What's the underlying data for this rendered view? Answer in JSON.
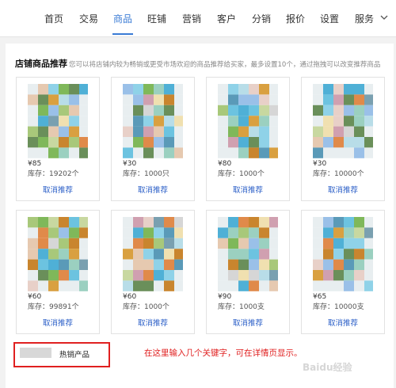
{
  "nav": {
    "items": [
      "首页",
      "交易",
      "商品",
      "旺铺",
      "营销",
      "客户",
      "分销",
      "报价",
      "设置",
      "服务"
    ],
    "active_index": 2,
    "active_color": "#3a7bd5"
  },
  "section": {
    "title": "店铺商品推荐",
    "description": "您可以将店铺内较为畅销或更受市场欢迎的商品推荐给买家，最多设置10个，通过拖拽可以改变推荐商品"
  },
  "products": [
    {
      "price": "¥85",
      "stock": "库存：19202个",
      "action": "取消推荐"
    },
    {
      "price": "¥30",
      "stock": "库存：1000只",
      "action": "取消推荐"
    },
    {
      "price": "¥80",
      "stock": "库存：1000个",
      "action": "取消推荐"
    },
    {
      "price": "¥30",
      "stock": "库存：10000个",
      "action": "取消推荐"
    },
    {
      "price": "¥60",
      "stock": "库存：99891个",
      "action": "取消推荐"
    },
    {
      "price": "¥60",
      "stock": "库存：1000个",
      "action": "取消推荐"
    },
    {
      "price": "¥90",
      "stock": "库存：1000支",
      "action": "取消推荐"
    },
    {
      "price": "¥65",
      "stock": "库存：10000支",
      "action": "取消推荐"
    }
  ],
  "keyword": {
    "text": "热销产品"
  },
  "annotation": {
    "text": "在这里输入几个关键字，可在详情页显示。",
    "color": "#e02020"
  },
  "watermark": {
    "text": "Baidu经验"
  }
}
